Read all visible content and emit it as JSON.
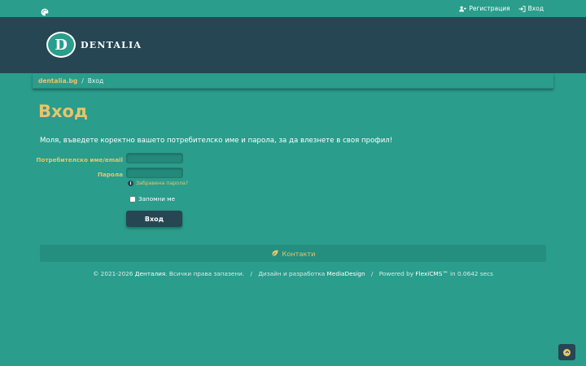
{
  "topbar": {
    "register_label": "Регистрация",
    "login_label": "Вход"
  },
  "header": {
    "logo_letter": "D",
    "logo_text": "DENTALIA"
  },
  "breadcrumb": {
    "home": "dentalia.bg",
    "separator": "/",
    "current": "Вход"
  },
  "main": {
    "title": "Вход",
    "intro": "Моля, въведете коректно вашето потребителско име и парола, за да влезнете в своя профил!",
    "form": {
      "username_label": "Потребителско име/email",
      "username_value": "",
      "password_label": "Парола",
      "password_value": "",
      "forgot_info_glyph": "i",
      "forgot_password": "Забравена парола?",
      "remember_me": "Запомни ме",
      "submit_label": "Вход"
    }
  },
  "contacts": {
    "label": "Контакти"
  },
  "footer": {
    "copyright_prefix": "© 2021-2026",
    "site_name": "Денталия",
    "rights": ". Всички права запазени.",
    "separator": "/",
    "design_prefix": "Дизайн и разработка",
    "design_company": "MediaDesign",
    "powered_prefix": "Powered by",
    "cms_name": "FlexiCMS™",
    "timing": "in 0.0642 secs"
  },
  "colors": {
    "background": "#2a9d8c",
    "header": "#264653",
    "accent": "#e9c46a"
  },
  "icons": {
    "palette": "palette-icon",
    "register": "user-plus-icon",
    "login": "sign-in-icon",
    "info": "info-circle-icon",
    "contacts": "leaf-icon",
    "scroll_top": "chevron-up-icon"
  }
}
